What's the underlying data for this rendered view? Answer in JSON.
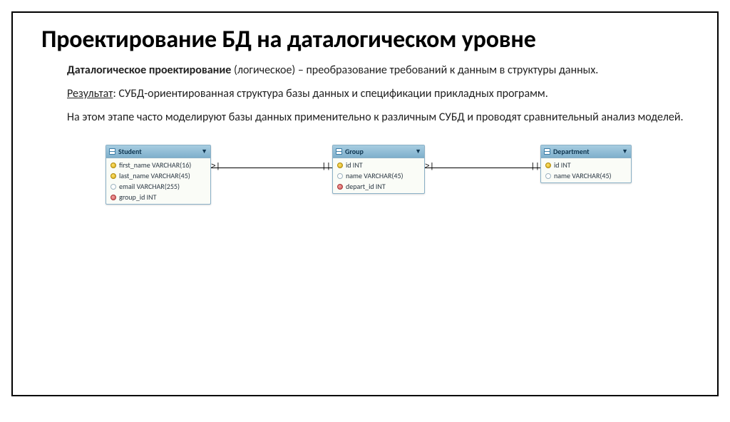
{
  "title": "Проектирование БД на даталогическом уровне",
  "para1_bold": "Даталогическое проектирование",
  "para1_rest": " (логическое) – преобразование требований к данным в структуры данных.",
  "para2_label": "Результат",
  "para2_rest": ": СУБД-ориентированная структура базы данных и спецификации прикладных программ.",
  "para3": "На этом этапе часто моделируют базы данных применительно к различным СУБД и проводят сравнительный анализ моделей.",
  "tables": {
    "student": {
      "name": "Student",
      "fields": [
        {
          "icon": "pk",
          "label": "first_name VARCHAR(16)"
        },
        {
          "icon": "pk",
          "label": "last_name VARCHAR(45)"
        },
        {
          "icon": "col",
          "label": "email VARCHAR(255)"
        },
        {
          "icon": "fk",
          "label": "group_id INT"
        }
      ]
    },
    "group": {
      "name": "Group",
      "fields": [
        {
          "icon": "pk",
          "label": "id INT"
        },
        {
          "icon": "col",
          "label": "name VARCHAR(45)"
        },
        {
          "icon": "fk",
          "label": "depart_id INT"
        }
      ]
    },
    "department": {
      "name": "Department",
      "fields": [
        {
          "icon": "pk",
          "label": "id INT"
        },
        {
          "icon": "col",
          "label": "name VARCHAR(45)"
        }
      ]
    }
  }
}
